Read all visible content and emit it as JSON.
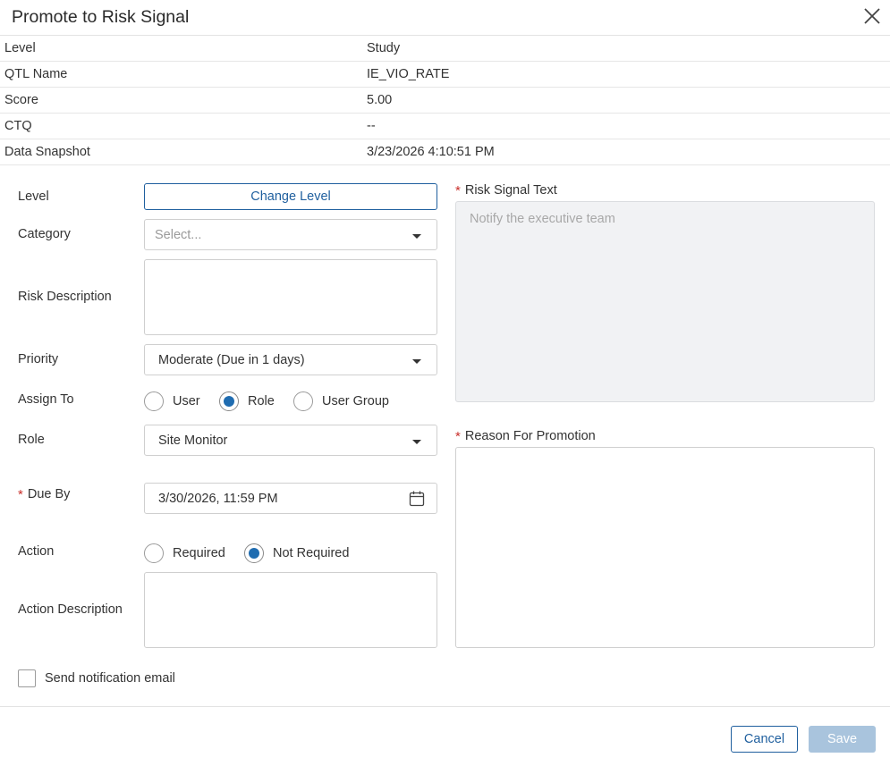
{
  "dialog": {
    "title": "Promote to Risk Signal",
    "close_icon": "close-icon"
  },
  "summary": [
    {
      "label": "Level",
      "value": "Study"
    },
    {
      "label": "QTL Name",
      "value": "IE_VIO_RATE"
    },
    {
      "label": "Score",
      "value": "5.00"
    },
    {
      "label": "CTQ",
      "value": "--"
    },
    {
      "label": "Data Snapshot",
      "value": "3/23/2026 4:10:51 PM"
    }
  ],
  "form": {
    "level": {
      "label": "Level",
      "button": "Change Level"
    },
    "category": {
      "label": "Category",
      "placeholder": "Select..."
    },
    "risk_description": {
      "label": "Risk Description",
      "value": ""
    },
    "priority": {
      "label": "Priority",
      "value": "Moderate (Due in 1 days)"
    },
    "assign_to": {
      "label": "Assign To",
      "options": [
        "User",
        "Role",
        "User Group"
      ],
      "selected": "Role"
    },
    "role": {
      "label": "Role",
      "value": "Site Monitor"
    },
    "due_by": {
      "required_mark": "*",
      "label": "Due By",
      "value": "3/30/2026, 11:59 PM",
      "icon": "calendar-icon"
    },
    "action": {
      "label": "Action",
      "options": [
        "Required",
        "Not Required"
      ],
      "selected": "Not Required"
    },
    "action_description": {
      "label": "Action Description",
      "value": ""
    },
    "risk_signal_text": {
      "required_mark": "*",
      "label": "Risk Signal Text",
      "placeholder": "Notify the executive team"
    },
    "reason_for_promotion": {
      "required_mark": "*",
      "label": "Reason For Promotion",
      "value": ""
    },
    "send_notification": {
      "label": "Send notification email",
      "checked": false
    }
  },
  "footer": {
    "cancel": "Cancel",
    "save": "Save"
  },
  "colors": {
    "accent": "#1f5f9e",
    "radio_fill": "#1f6cb0",
    "required": "#c9302c",
    "save_disabled": "#a9c4dd"
  }
}
